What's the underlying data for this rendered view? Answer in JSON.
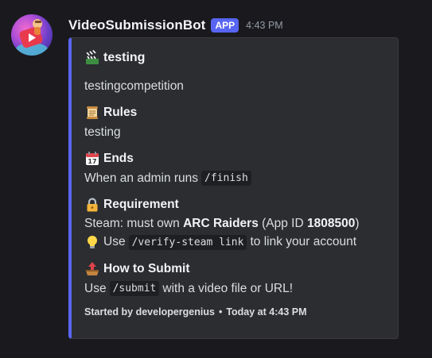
{
  "message": {
    "username": "VideoSubmissionBot",
    "badge": "APP",
    "timestamp": "4:43 PM"
  },
  "embed": {
    "accent_color": "#5865f2",
    "title_icon": "clapper-board-icon",
    "title": "testing",
    "description": "testingcompetition",
    "fields": {
      "rules": {
        "icon": "scroll-icon",
        "name": "Rules",
        "value": "testing"
      },
      "ends": {
        "icon": "calendar-icon",
        "name": "Ends",
        "value_prefix": "When an admin runs",
        "value_code": "/finish"
      },
      "requirement": {
        "icon": "lock-icon",
        "name": "Requirement",
        "line1_prefix": "Steam: must own",
        "line1_game": "ARC Raiders",
        "line1_appid_prefix": "(App ID",
        "line1_appid": "1808500",
        "line1_suffix": ")",
        "line2_icon": "lightbulb-icon",
        "line2_prefix": "Use",
        "line2_code": "/verify-steam link",
        "line2_suffix": "to link your account"
      },
      "submit": {
        "icon": "outbox-tray-icon",
        "name": "How to Submit",
        "value_prefix": "Use",
        "value_code": "/submit",
        "value_suffix": "with a video file or URL!"
      }
    },
    "footer": {
      "started_by": "Started by developergenius",
      "separator": "•",
      "time": "Today at 4:43 PM"
    }
  }
}
